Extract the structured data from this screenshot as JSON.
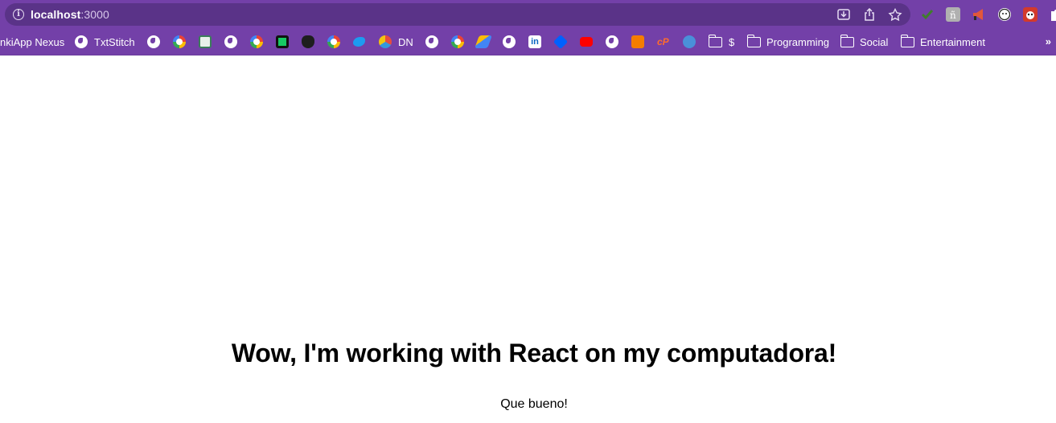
{
  "browser": {
    "url_host": "localhost",
    "url_port": ":3000",
    "omnibox_actions": [
      "install-icon",
      "share-icon",
      "bookmark-star-icon"
    ],
    "extensions": [
      {
        "name": "extension-check-icon",
        "color": "#3f7d2c"
      },
      {
        "name": "extension-font-icon",
        "color": "#b0b0b0"
      },
      {
        "name": "extension-megaphone-icon",
        "color": "#e2573b"
      },
      {
        "name": "extension-face-icon",
        "color": "#ffffff"
      },
      {
        "name": "extension-panda-icon",
        "color": "#d33a2c"
      },
      {
        "name": "extensions-puzzle-icon",
        "color": "#ffffff"
      }
    ]
  },
  "bookmarks": {
    "items": [
      {
        "label": "nkiApp Nexus",
        "icon": "none"
      },
      {
        "label": "TxtStitch",
        "icon": "globe-icon"
      },
      {
        "label": "",
        "icon": "globe-icon"
      },
      {
        "label": "",
        "icon": "google-icon"
      },
      {
        "label": "",
        "icon": "app-icon"
      },
      {
        "label": "",
        "icon": "globe-icon"
      },
      {
        "label": "",
        "icon": "google-icon"
      },
      {
        "label": "",
        "icon": "app-icon"
      },
      {
        "label": "",
        "icon": "owl-icon"
      },
      {
        "label": "",
        "icon": "google-icon"
      },
      {
        "label": "",
        "icon": "twitter-icon"
      },
      {
        "label": "DN",
        "icon": "app-icon"
      },
      {
        "label": "",
        "icon": "globe-icon"
      },
      {
        "label": "",
        "icon": "google-icon"
      },
      {
        "label": "",
        "icon": "ads-icon"
      },
      {
        "label": "",
        "icon": "globe-icon"
      },
      {
        "label": "",
        "icon": "linkedin-icon"
      },
      {
        "label": "",
        "icon": "dropbox-icon"
      },
      {
        "label": "",
        "icon": "youtube-icon"
      },
      {
        "label": "",
        "icon": "globe-icon"
      },
      {
        "label": "",
        "icon": "blogger-icon"
      },
      {
        "label": "",
        "icon": "cpanel-icon"
      },
      {
        "label": "",
        "icon": "app-icon"
      },
      {
        "label": "$",
        "icon": "folder-icon"
      },
      {
        "label": "Programming",
        "icon": "folder-icon"
      },
      {
        "label": "Social",
        "icon": "folder-icon"
      },
      {
        "label": "Entertainment",
        "icon": "folder-icon"
      }
    ],
    "overflow": "»"
  },
  "page": {
    "heading": "Wow, I'm working with React on my computadora!",
    "subtext": "Que bueno!"
  },
  "colors": {
    "chrome": "#7340a8",
    "omnibox": "#5a3388"
  }
}
